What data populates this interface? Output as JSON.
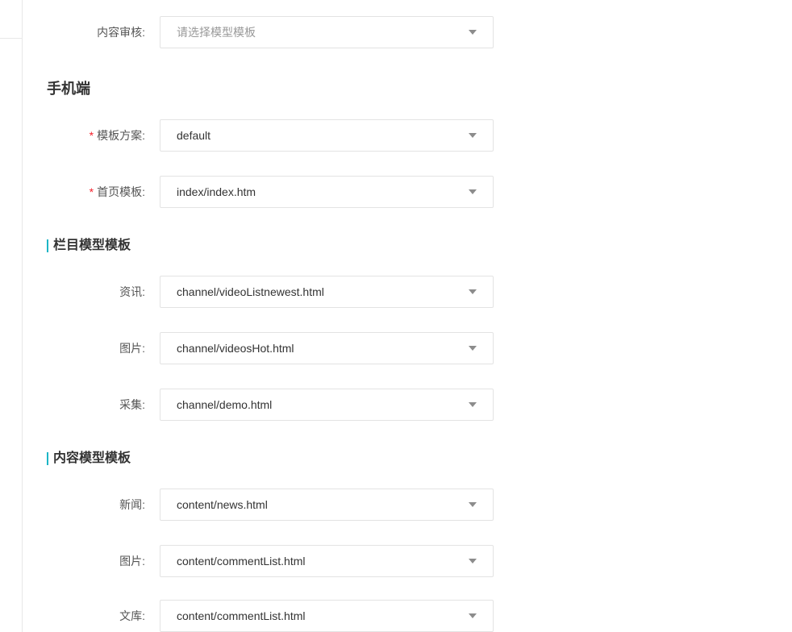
{
  "content_review": {
    "label": "内容审核:",
    "placeholder": "请选择模型模板"
  },
  "mobile": {
    "title": "手机端",
    "template_scheme": {
      "required": "*",
      "label": "模板方案:",
      "value": "default"
    },
    "home_template": {
      "required": "*",
      "label": "首页模板:",
      "value": "index/index.htm"
    }
  },
  "channel_templates": {
    "title": "栏目模型模板",
    "items": [
      {
        "label": "资讯:",
        "value": "channel/videoListnewest.html"
      },
      {
        "label": "图片:",
        "value": "channel/videosHot.html"
      },
      {
        "label": "采集:",
        "value": "channel/demo.html"
      }
    ]
  },
  "content_templates": {
    "title": "内容模型模板",
    "items": [
      {
        "label": "新闻:",
        "value": "content/news.html"
      },
      {
        "label": "图片:",
        "value": "content/commentList.html"
      },
      {
        "label": "文库:",
        "value": "content/commentList.html"
      }
    ]
  },
  "colors": {
    "accent_bar": "#1cb5c6",
    "required": "#f5222d"
  },
  "icons": {
    "select_caret": "caret-down-icon"
  }
}
